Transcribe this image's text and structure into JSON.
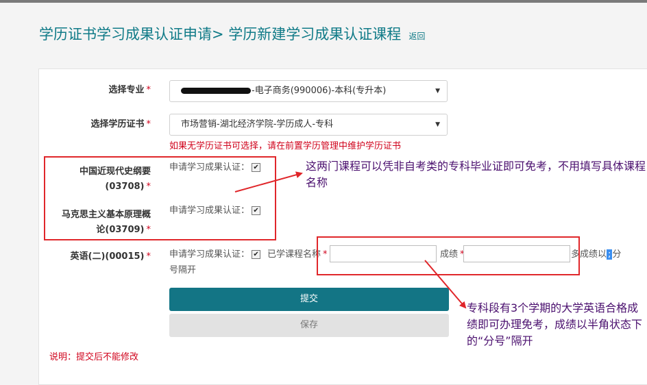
{
  "breadcrumb": {
    "title": "学历证书学习成果认证申请> 学历新建学习成果认证课程",
    "back_label": "返回"
  },
  "form": {
    "major": {
      "label": "选择专业",
      "required_mark": "*",
      "value": "-电子商务(990006)-本科(专升本)"
    },
    "certificate": {
      "label": "选择学历证书",
      "required_mark": "*",
      "value": "市场营销-湖北经济学院-学历成人-专科",
      "warning": "如果无学历证书可选择，请在前置学历管理中维护学历证书"
    },
    "courses": [
      {
        "name_line1": "中国近现代史纲要",
        "name_line2": "(03708)",
        "required_mark": "*",
        "apply_label": "申请学习成果认证：",
        "checked": "✔"
      },
      {
        "name_line1": "马克思主义基本原理概",
        "name_line2": "论(03709)",
        "required_mark": "*",
        "apply_label": "申请学习成果认证：",
        "checked": "✔"
      },
      {
        "name_line1": "英语(二)(00015)",
        "required_mark": "*",
        "apply_label": "申请学习成果认证：",
        "checked": "✔",
        "studied_label": "已学课程名称",
        "studied_value": "",
        "score_label": "成绩",
        "score_value": "",
        "multi_score_hint_start": "多成绩以",
        "multi_score_hint_sel": ";",
        "multi_score_hint_end": "分",
        "multi_score_hint_line2": "号隔开"
      }
    ],
    "submit_label": "提交",
    "save_label": "保存",
    "note": "说明：提交后不能修改"
  },
  "annotations": {
    "note1": "这两门课程可以凭非自考类的专科毕业证即可免考，不用填写具体课程名称",
    "note2": "专科段有3个学期的大学英语合格成绩即可办理免考，成绩以半角状态下的“分号”隔开"
  },
  "colors": {
    "accent": "#137585",
    "title": "#0f7a87",
    "required": "#d0021b",
    "annotation_box": "#e0262a",
    "annotation_text": "#4a0f6e"
  }
}
